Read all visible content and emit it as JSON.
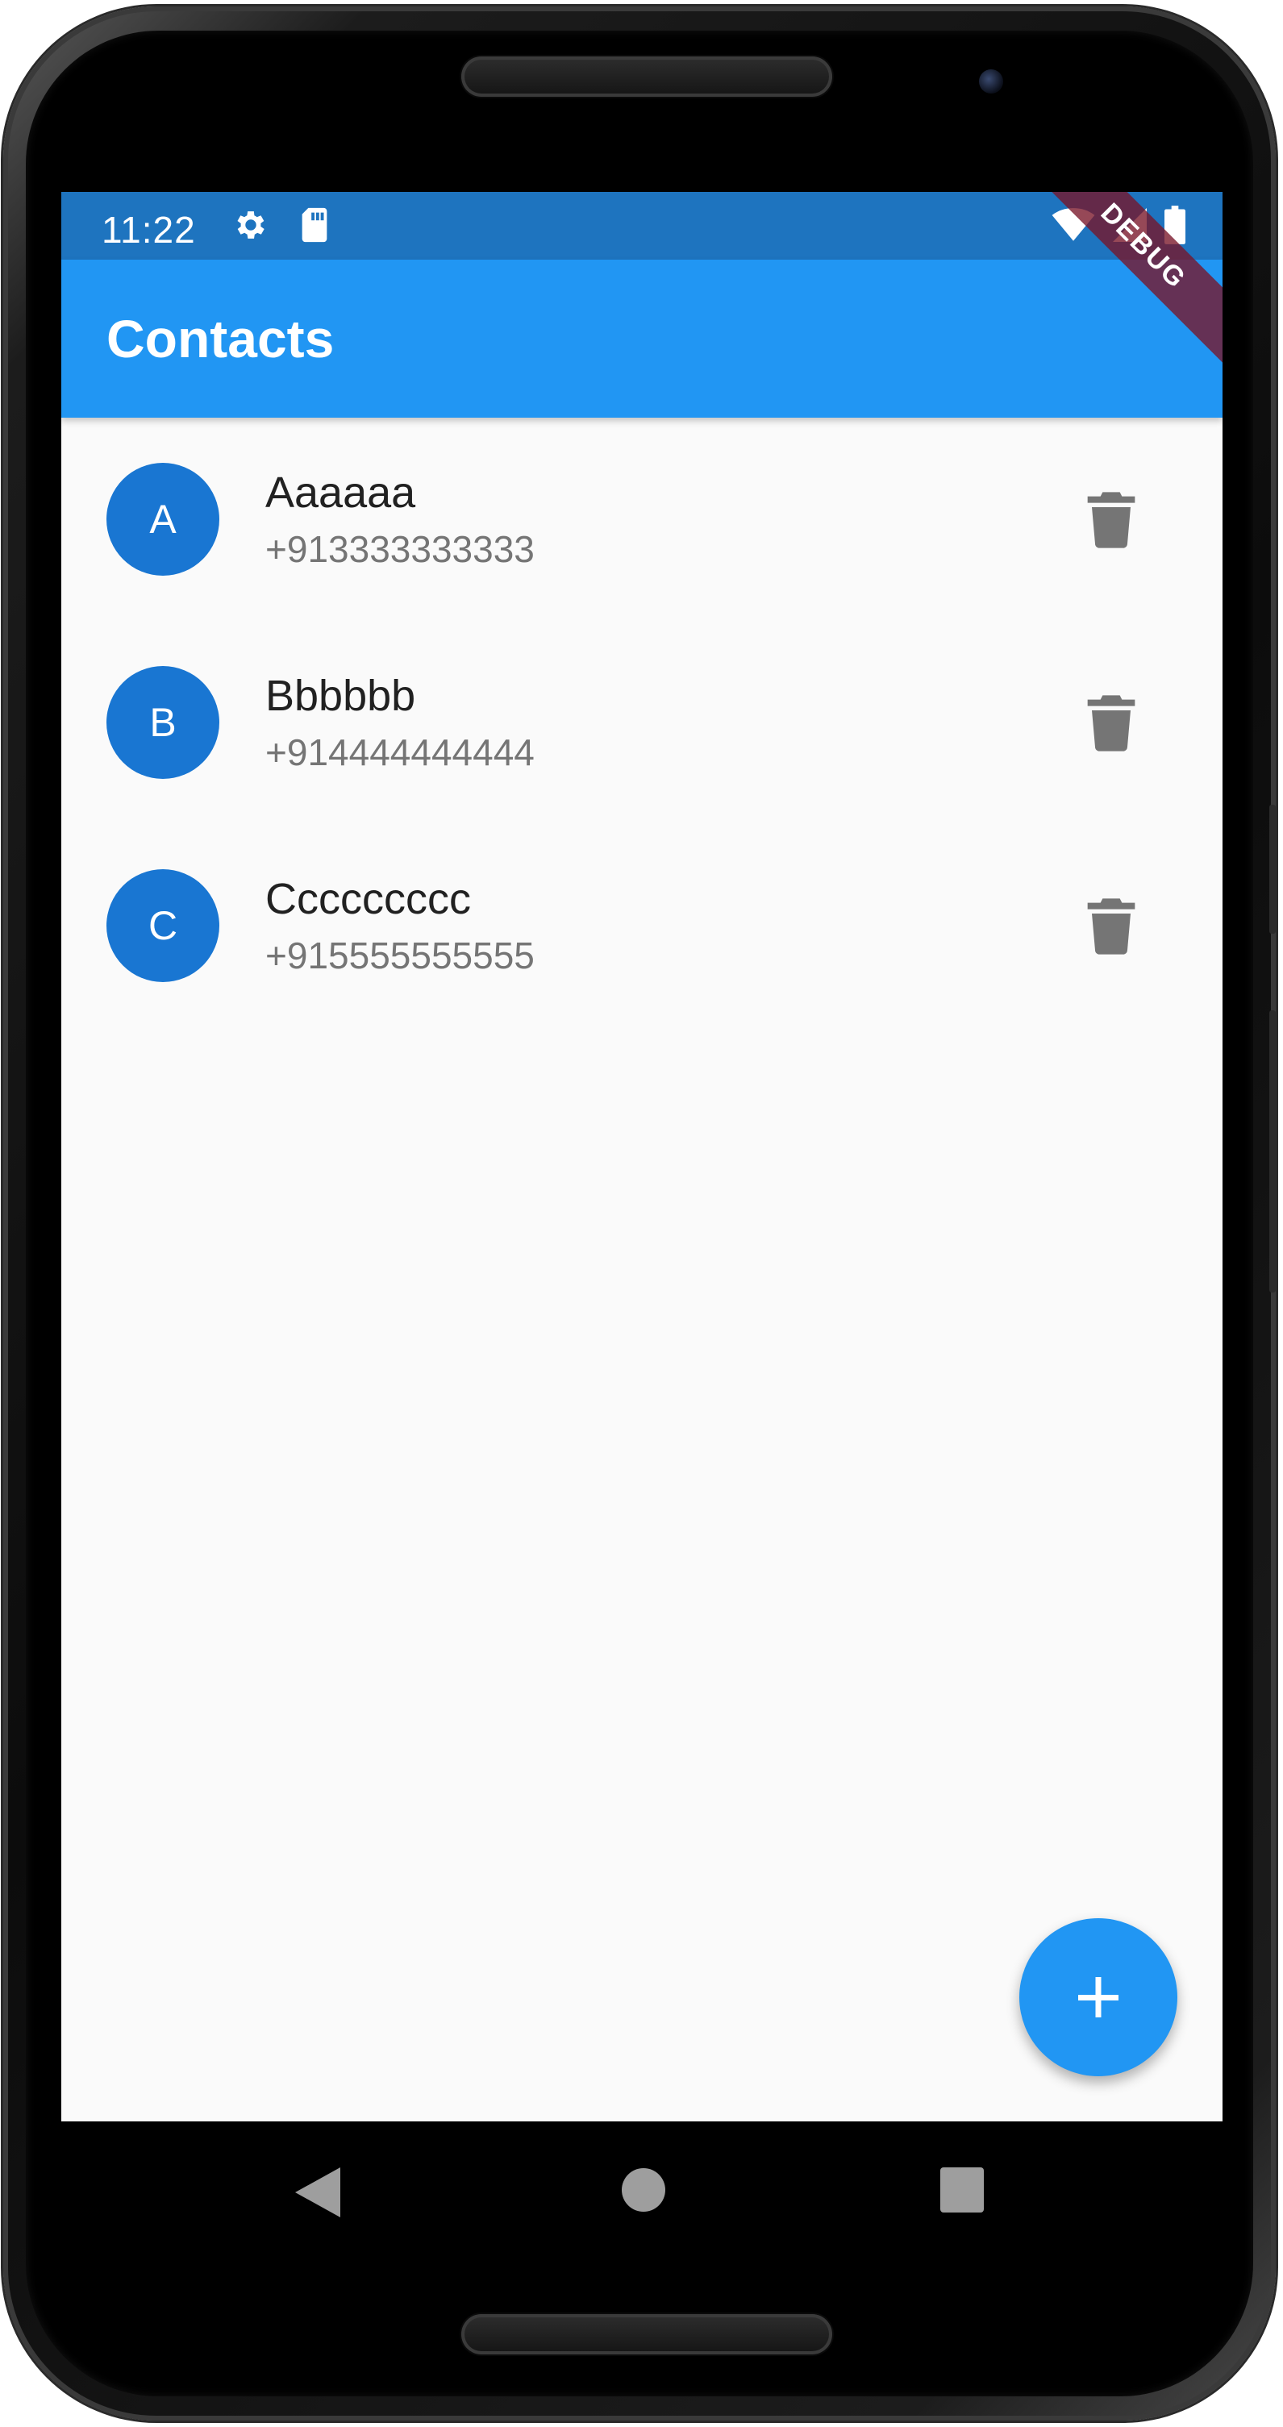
{
  "status_bar": {
    "time": "11:22",
    "left_icons": [
      "gear-icon",
      "sd-card-icon"
    ],
    "right_icons": [
      "wifi-icon",
      "signal-icon",
      "battery-icon"
    ]
  },
  "app_bar": {
    "title": "Contacts"
  },
  "debug_banner": {
    "label": "DEBUG"
  },
  "contacts": [
    {
      "initial": "A",
      "name": "Aaaaaa",
      "phone": "+913333333333"
    },
    {
      "initial": "B",
      "name": "Bbbbbb",
      "phone": "+914444444444"
    },
    {
      "initial": "C",
      "name": "Ccccccccc",
      "phone": "+915555555555"
    }
  ],
  "fab": {
    "icon": "plus-icon"
  },
  "nav_bar": {
    "icons": [
      "back-icon",
      "home-icon",
      "recents-icon"
    ]
  },
  "colors": {
    "primary": "#2196f3",
    "status_bar": "#1e74bf",
    "avatar": "#1976d2",
    "background": "#fafafa",
    "icon_grey": "#757575"
  }
}
